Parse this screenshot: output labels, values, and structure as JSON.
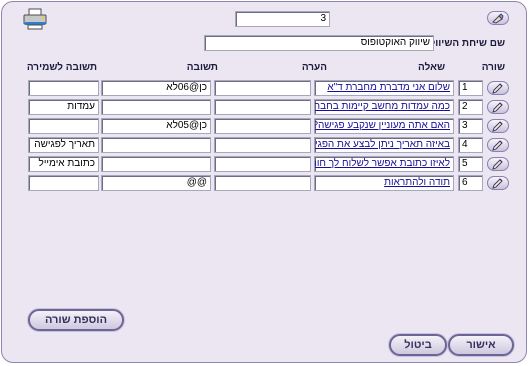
{
  "header": {
    "row_number_value": "3",
    "campaign_name_label": "שם שיחת השיווק",
    "campaign_name_value": "שיווק האוקטופוס"
  },
  "columns": {
    "row": "שורה",
    "question": "שאלה",
    "comment": "הערה",
    "answer": "תשובה",
    "answer_to_save": "תשובה לשמירה"
  },
  "rows": [
    {
      "num": "1",
      "question": "שלום      אני מדברת מחברת ד\"א",
      "comment": "",
      "answer": "כן@06לא",
      "save": ""
    },
    {
      "num": "2",
      "question": "כמה עמדות מחשב קיימות בחברתך?",
      "comment": "",
      "answer": "",
      "save": "עמדות"
    },
    {
      "num": "3",
      "question": "האם אתה מעוניין שנקבע פגישה?",
      "comment": "",
      "answer": "כן@05לא",
      "save": ""
    },
    {
      "num": "4",
      "question": "באיזה תאריך ניתן לבצע את הפגישה?",
      "comment": "",
      "answer": "",
      "save": "תאריך לפגישה"
    },
    {
      "num": "5",
      "question": "לאיזו כתובת אפשר לשלוח לך חומר?",
      "comment": "",
      "answer": "",
      "save": "כתובת אימייל"
    },
    {
      "num": "6",
      "question": "תודה ולהתראות",
      "comment": "",
      "answer": "@@",
      "save": ""
    }
  ],
  "buttons": {
    "add_row": "הוספת שורה",
    "confirm": "אישור",
    "cancel": "ביטול"
  },
  "icons": {
    "header_edit": "eraser-pencil-icon",
    "print": "printer-icon",
    "row_edit": "pencil-icon"
  },
  "colors": {
    "background": "#ebe6f2",
    "border": "#8d86ad",
    "link_text": "#18109a"
  }
}
